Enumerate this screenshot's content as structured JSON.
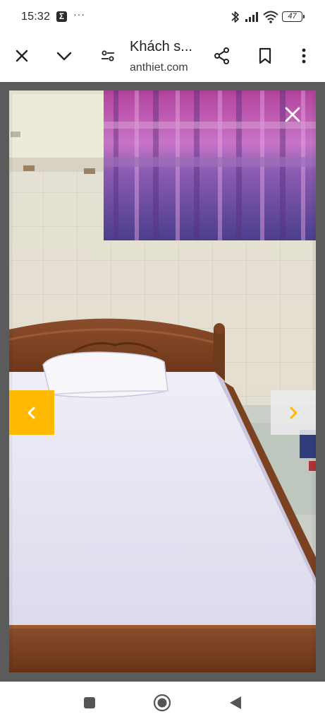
{
  "status_bar": {
    "time": "15:32",
    "notification_badge": "Σ",
    "more_notifications": "···",
    "battery_level": "47",
    "icons": [
      "bluetooth-icon",
      "signal-icon",
      "wifi-icon",
      "battery-icon"
    ]
  },
  "toolbar": {
    "page_title": "Khách s...",
    "page_url": "anthiet.com",
    "icons": [
      "close-icon",
      "chevron-down-icon",
      "tune-icon",
      "share-icon",
      "bookmark-icon",
      "more-vert-icon"
    ]
  },
  "gallery": {
    "image_subject": "hotel room with bed, pillow and purple curtain",
    "prev_icon": "chevron-left-icon",
    "next_icon": "chevron-right-icon",
    "close_icon": "close-icon",
    "colors": {
      "prev_button": "#ffb900",
      "next_arrow": "#ffb900",
      "backdrop": "#5b5b5b"
    }
  },
  "system_nav": {
    "icons": [
      "recents-icon",
      "home-icon",
      "back-icon"
    ]
  }
}
